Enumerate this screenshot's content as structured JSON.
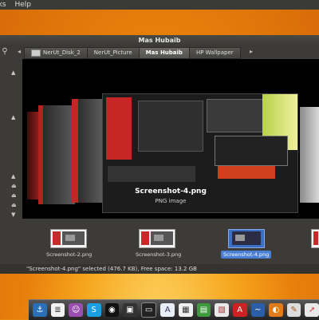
{
  "menubar": {
    "items": [
      "rks",
      "Help"
    ]
  },
  "window": {
    "title": "Mas Hubaib",
    "breadcrumbs": [
      "NerUt_Disk_2",
      "NerUt_Picture",
      "Mas Hubaib",
      "HP Wallpaper"
    ],
    "active_breadcrumb": "Mas Hubaib"
  },
  "preview": {
    "filename": "Screenshot-4.png",
    "filetype": "PNG image"
  },
  "thumbnails": [
    {
      "label": "Screenshot-2.png",
      "selected": false
    },
    {
      "label": "Screenshot-3.png",
      "selected": false
    },
    {
      "label": "Screenshot-4.png",
      "selected": true
    }
  ],
  "status": {
    "text": "\"Screenshot-4.png\" selected (476.7 KB), Free space: 13.2 GB"
  },
  "dock": {
    "items": [
      "anchor-icon",
      "document-icon",
      "chat-icon",
      "skype-icon",
      "disc-icon",
      "clapper-icon",
      "monitor-icon",
      "text-icon",
      "calendar-icon",
      "spreadsheet-icon",
      "presentation-icon",
      "pdf-icon",
      "wave-icon",
      "blender-icon",
      "pencil-icon",
      "arrow-icon"
    ]
  },
  "colors": {
    "desktop": "#e88a10",
    "selection": "#4a7fd6",
    "window": "#3c3b37"
  }
}
